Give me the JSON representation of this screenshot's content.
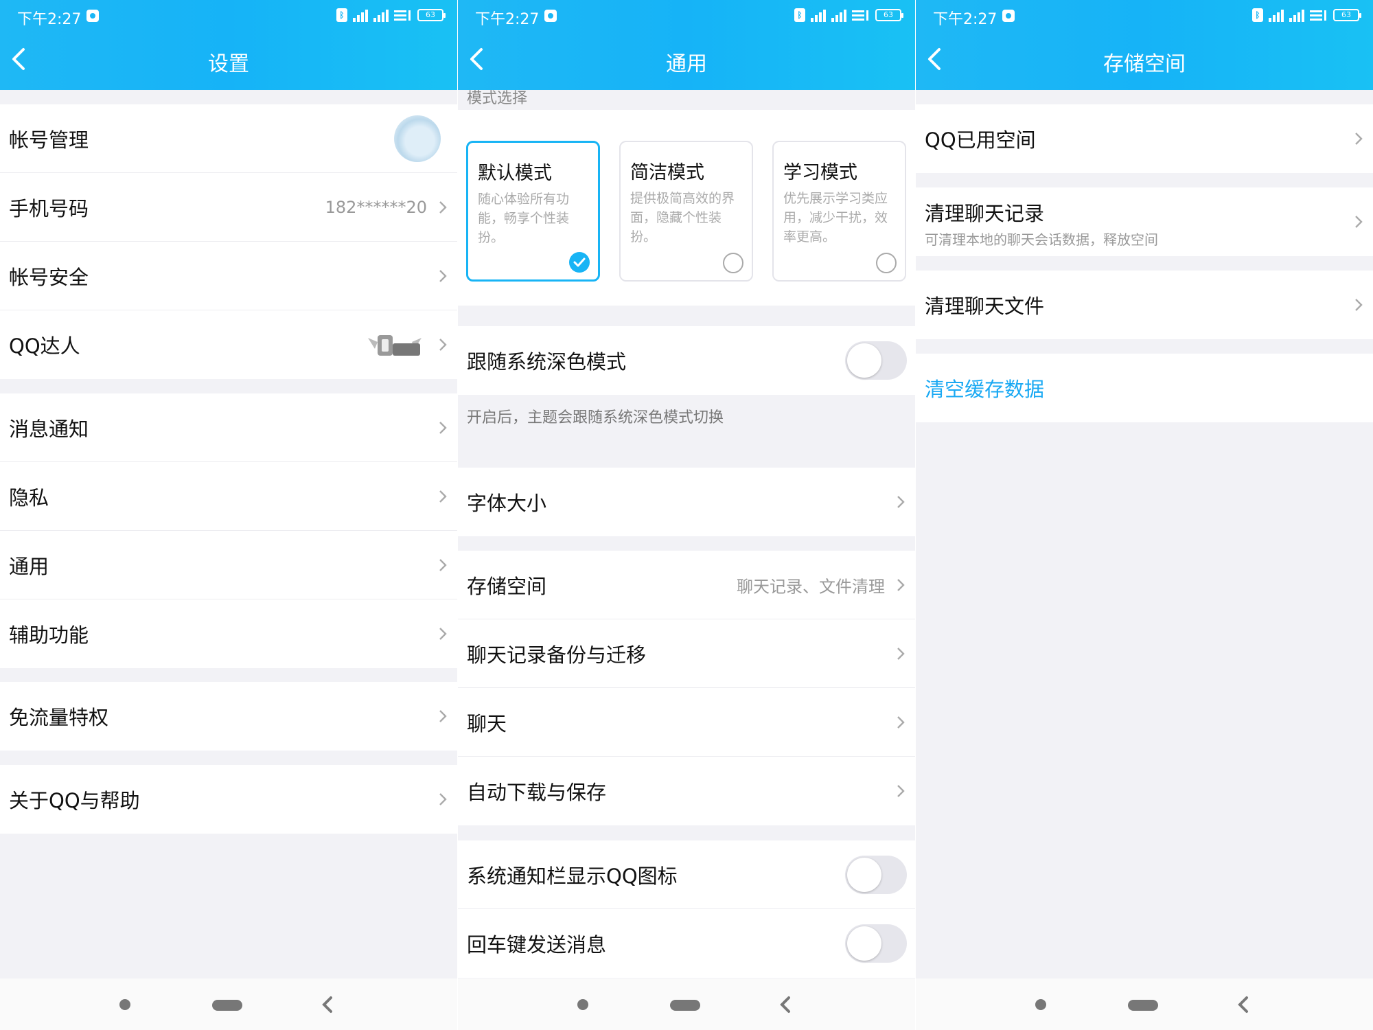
{
  "status_bar": {
    "time": "下午2:27",
    "bluetooth": "bluetooth-icon",
    "signal": "signal-icon",
    "wifi": "wifi-icon",
    "battery": "63"
  },
  "screens": {
    "settings": {
      "title": "设置",
      "groups": [
        [
          {
            "label": "帐号管理"
          },
          {
            "label": "手机号码",
            "value": "182******20"
          },
          {
            "label": "帐号安全"
          },
          {
            "label": "QQ达人"
          }
        ],
        [
          {
            "label": "消息通知"
          },
          {
            "label": "隐私"
          },
          {
            "label": "通用"
          },
          {
            "label": "辅助功能"
          }
        ],
        [
          {
            "label": "免流量特权"
          }
        ],
        [
          {
            "label": "关于QQ与帮助"
          }
        ]
      ]
    },
    "general": {
      "title": "通用",
      "section_label": "模式选择",
      "modes": [
        {
          "name": "默认模式",
          "desc": "随心体验所有功能，畅享个性装扮。",
          "selected": true
        },
        {
          "name": "简洁模式",
          "desc": "提供极简高效的界面，隐藏个性装扮。",
          "selected": false
        },
        {
          "name": "学习模式",
          "desc": "优先展示学习类应用，减少干扰，效率更高。",
          "selected": false
        }
      ],
      "dark_follow": {
        "label": "跟随系统深色模式",
        "on": false
      },
      "dark_note": "开启后，主题会跟随系统深色模式切换",
      "font_size": "字体大小",
      "storage": {
        "label": "存储空间",
        "value": "聊天记录、文件清理"
      },
      "backup": "聊天记录备份与迁移",
      "chat": "聊天",
      "auto_download": "自动下载与保存",
      "notify_icon": {
        "label": "系统通知栏显示QQ图标",
        "on": false
      },
      "enter_send": {
        "label": "回车键发送消息",
        "on": false
      }
    },
    "storage": {
      "title": "存储空间",
      "used": "QQ已用空间",
      "clear_chat": {
        "label": "清理聊天记录",
        "sub": "可清理本地的聊天会话数据，释放空间"
      },
      "clear_files": "清理聊天文件",
      "clear_cache": "清空缓存数据"
    }
  },
  "colors": {
    "header": "#17b5f6",
    "accent": "#18b4f5",
    "link": "#1aa9f3"
  }
}
